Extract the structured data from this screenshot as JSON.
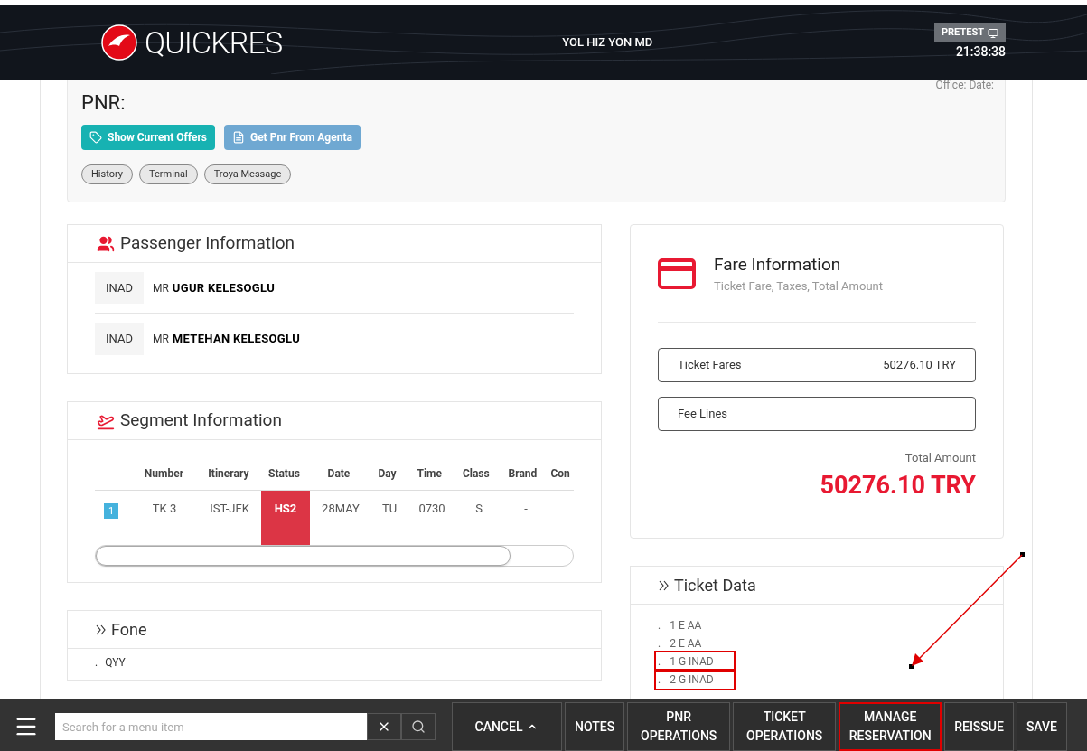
{
  "header": {
    "logo_text": "QUICKRES",
    "user": "YOL HIZ YON MD",
    "environment": "PRETEST",
    "time": "21:38:38"
  },
  "pnr": {
    "title": "PNR:",
    "office_date": "Office: Date:",
    "actions": [
      {
        "label": "Show Current Offers",
        "kind": "offers"
      },
      {
        "label": "Get Pnr From Agenta",
        "kind": "agenta"
      }
    ],
    "chips": [
      "History",
      "Terminal",
      "Troya Message"
    ]
  },
  "passengers": {
    "title": "Passenger Information",
    "rows": [
      {
        "type": "INAD",
        "title": "MR",
        "name": "UGUR KELESOGLU"
      },
      {
        "type": "INAD",
        "title": "MR",
        "name": "METEHAN KELESOGLU"
      }
    ]
  },
  "segments": {
    "title": "Segment Information",
    "columns": [
      "Number",
      "Itinerary",
      "Status",
      "Date",
      "Day",
      "Time",
      "Class",
      "Brand",
      "Con"
    ],
    "rows": [
      {
        "index": "1",
        "cells": [
          "TK 3",
          "IST-JFK",
          "HS2",
          "28MAY",
          "TU",
          "0730",
          "S",
          "-"
        ]
      }
    ]
  },
  "fone": {
    "title": "Fone",
    "items": [
      {
        "marker": ".",
        "text": "QYY"
      }
    ]
  },
  "fare": {
    "title": "Fare Information",
    "subtitle": "Ticket Fare, Taxes, Total Amount",
    "lines": [
      {
        "label": "Ticket Fares",
        "value": "50276.10 TRY"
      },
      {
        "label": "Fee Lines"
      }
    ],
    "total_label": "Total Amount",
    "total_value": "50276.10 TRY"
  },
  "ticket_data": {
    "title": "Ticket Data",
    "items": [
      {
        "marker": ".",
        "text": "1 E AA",
        "highlighted": false
      },
      {
        "marker": ".",
        "text": "2 E AA",
        "highlighted": false
      },
      {
        "marker": ".",
        "text": "1 G INAD",
        "highlighted": true
      },
      {
        "marker": ".",
        "text": "2 G INAD",
        "highlighted": true
      }
    ]
  },
  "bottom_bar": {
    "search_placeholder": "Search for a menu item",
    "buttons": [
      {
        "label": "CANCEL",
        "caret": true,
        "highlighted": false
      },
      {
        "label": "NOTES",
        "caret": false,
        "highlighted": false
      },
      {
        "label": "PNR OPERATIONS",
        "caret": false,
        "highlighted": false
      },
      {
        "label": "TICKET OPERATIONS",
        "caret": false,
        "highlighted": false
      },
      {
        "label": "MANAGE RESERVATION",
        "caret": false,
        "highlighted": true
      },
      {
        "label": "REISSUE",
        "caret": false,
        "highlighted": false
      },
      {
        "label": "SAVE",
        "caret": false,
        "highlighted": false
      }
    ]
  }
}
